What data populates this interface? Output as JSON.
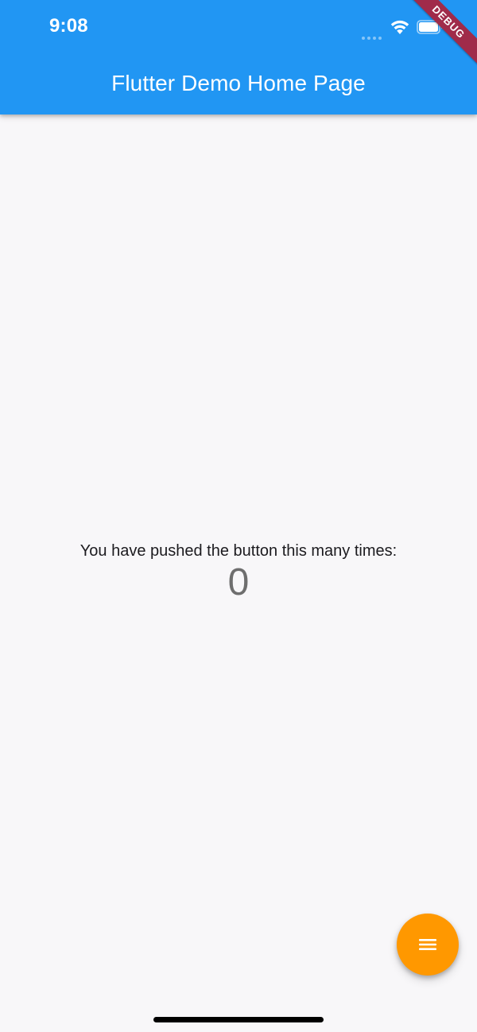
{
  "status_bar": {
    "time": "9:08"
  },
  "app_bar": {
    "title": "Flutter Demo Home Page"
  },
  "debug_banner": {
    "label": "DEBUG"
  },
  "main": {
    "counter_label": "You have pushed the button this many times:",
    "counter_value": "0"
  },
  "fab": {
    "icon": "menu-icon"
  },
  "colors": {
    "app_bar": "#2196f3",
    "background": "#f8f7f9",
    "fab": "#ff9800",
    "debug_banner": "#a02b4a"
  }
}
